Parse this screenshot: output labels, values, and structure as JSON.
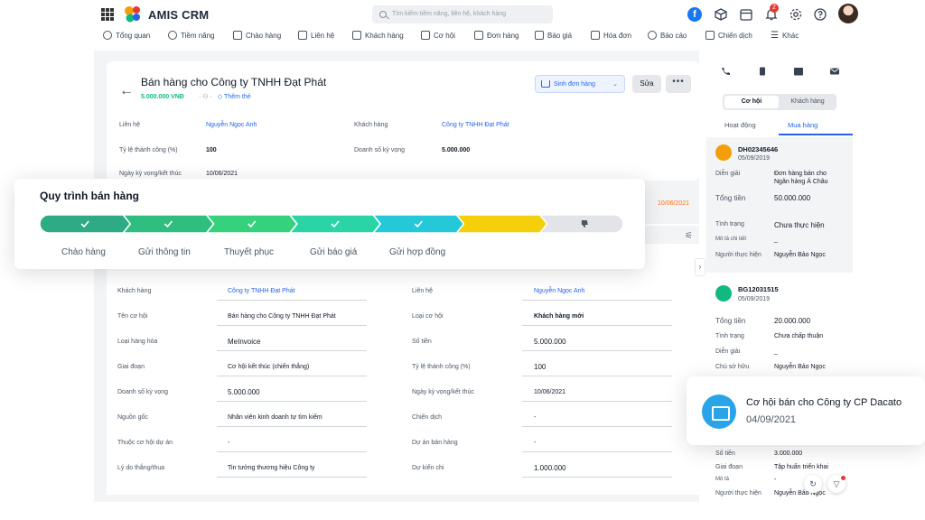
{
  "app": {
    "brand": "AMIS CRM"
  },
  "search": {
    "placeholder": "Tìm kiếm tiềm năng, liên hệ, khách hàng"
  },
  "topbar": {
    "notification_count": "2",
    "facebook_letter": "f"
  },
  "nav": {
    "items": [
      {
        "label": "Tổng quan",
        "icon": "dashboard-icon"
      },
      {
        "label": "Tiềm năng",
        "icon": "leads-icon"
      },
      {
        "label": "Chào hàng",
        "icon": "offer-icon"
      },
      {
        "label": "Liên hệ",
        "icon": "contact-icon"
      },
      {
        "label": "Khách hàng",
        "icon": "customer-icon"
      },
      {
        "label": "Cơ hội",
        "icon": "opportunity-icon"
      },
      {
        "label": "Đơn hàng",
        "icon": "cart-icon"
      },
      {
        "label": "Báo giá",
        "icon": "quote-icon"
      },
      {
        "label": "Hóa đơn",
        "icon": "invoice-icon"
      },
      {
        "label": "Báo cáo",
        "icon": "report-icon"
      },
      {
        "label": "Chiến dịch",
        "icon": "campaign-icon"
      },
      {
        "label": "Khác",
        "icon": "menu-icon"
      }
    ]
  },
  "header": {
    "back": "←",
    "title": "Bán hàng cho Công ty TNHH Đạt Phát",
    "amount": "5.000.000 VNĐ",
    "add_tag": "Thêm thẻ",
    "create_order": "Sinh đơn hàng",
    "edit": "Sửa",
    "more": "•••"
  },
  "summary": {
    "contact_label": "Liên hệ",
    "contact_value": "Nguyễn Ngọc Anh",
    "customer_label": "Khách hàng",
    "customer_value": "Công ty TNHH Đạt Phát",
    "rate_label": "Tỷ lệ thành công (%)",
    "rate_value": "100",
    "expected_label": "Doanh số kỳ vọng",
    "expected_value": "5.000.000",
    "date_label": "Ngày kỳ vọng/kết thúc",
    "date_value": "10/06/2021",
    "due_date": "10/06/2021"
  },
  "process": {
    "title": "Quy trình bán hàng",
    "stages": [
      {
        "label": "Chào hàng",
        "color": "#2eaa84",
        "done": true
      },
      {
        "label": "Gửi thông tin",
        "color": "#2fbe7f",
        "done": true
      },
      {
        "label": "Thuyết phục",
        "color": "#36d17c",
        "done": true
      },
      {
        "label": "Gửi báo giá",
        "color": "#2bd4a5",
        "done": true
      },
      {
        "label": "Gửi hợp đồng",
        "color": "#24c8d8",
        "done": true
      },
      {
        "label": "",
        "color": "#f5cf0a",
        "done": false
      },
      {
        "label": "",
        "color": "#e2e4e8",
        "done": false
      }
    ]
  },
  "details": {
    "left": [
      {
        "label": "Khách hàng",
        "value": "Công ty TNHH Đạt Phát",
        "style": "link"
      },
      {
        "label": "Tên cơ hội",
        "value": "Bán hàng cho Công ty TNHH Đạt Phát",
        "style": ""
      },
      {
        "label": "Loại hàng hóa",
        "value": "MeInvoice",
        "style": "big"
      },
      {
        "label": "Giai đoạn",
        "value": "Cơ hội kết thúc (chiến thắng)",
        "style": ""
      },
      {
        "label": "Doanh số kỳ vọng",
        "value": "5.000.000",
        "style": "big"
      },
      {
        "label": "Nguồn gốc",
        "value": "Nhân viên kinh doanh tự tìm kiếm",
        "style": ""
      },
      {
        "label": "Thuộc cơ hội dự án",
        "value": "-",
        "style": ""
      },
      {
        "label": "Lý do thắng/thua",
        "value": "Tin tưởng thương hiệu Công ty",
        "style": ""
      }
    ],
    "right": [
      {
        "label": "Liên hệ",
        "value": "Nguyễn Ngọc Anh",
        "style": "link"
      },
      {
        "label": "Loại cơ hội",
        "value": "Khách hàng mới",
        "style": "bold"
      },
      {
        "label": "Số tiền",
        "value": "5.000.000",
        "style": "big"
      },
      {
        "label": "Tỷ lệ thành công (%)",
        "value": "100",
        "style": "big"
      },
      {
        "label": "Ngày kỳ vọng/kết thúc",
        "value": "10/06/2021",
        "style": ""
      },
      {
        "label": "Chiến dịch",
        "value": "-",
        "style": ""
      },
      {
        "label": "Dự án bán hàng",
        "value": "-",
        "style": ""
      },
      {
        "label": "Dự kiến chi",
        "value": "1.000.000",
        "style": "big"
      }
    ]
  },
  "right_panel": {
    "seg_on": "Cơ hội",
    "seg_off": "Khách hàng",
    "tab_activity": "Hoạt động",
    "tab_purchase": "Mua hàng",
    "order": {
      "id": "DH02345646",
      "date": "05/09/2019",
      "desc_label": "Diễn giải",
      "desc_value_1": "Đơn hàng bán cho",
      "desc_value_2": "Ngân hàng Á Châu",
      "total_label": "Tổng tiền",
      "total_value": "50.000.000",
      "status_label": "Tình trạng",
      "status_value": "Chưa thực hiện",
      "detail_label": "Mô tả chi tiết",
      "detail_value": "_",
      "assignee_label": "Người thực hiện",
      "assignee_value": "Nguyễn Bảo Ngọc"
    },
    "quote": {
      "id": "BG12031515",
      "date": "05/09/2019",
      "total_label": "Tổng tiền",
      "total_value": "20.000.000",
      "status_label": "Tình trạng",
      "status_value": "Chưa chấp thuận",
      "desc_label": "Diễn giải",
      "desc_value": "_",
      "owner_label": "Chủ sở hữu",
      "owner_value": "Nguyễn Bảo Ngọc"
    },
    "third": {
      "amount_label": "Số tiền",
      "amount_value": "3.000.000",
      "stage_label": "Giai đoạn",
      "stage_value": "Tập huấn triển khai",
      "desc_label": "Mô tả",
      "desc_value": "-",
      "assignee_label": "Người thực hiện",
      "assignee_value": "Nguyễn Bảo Ngọc"
    }
  },
  "toast": {
    "title": "Cơ hội bán cho Công ty CP Dacato",
    "date": "04/09/2021"
  }
}
